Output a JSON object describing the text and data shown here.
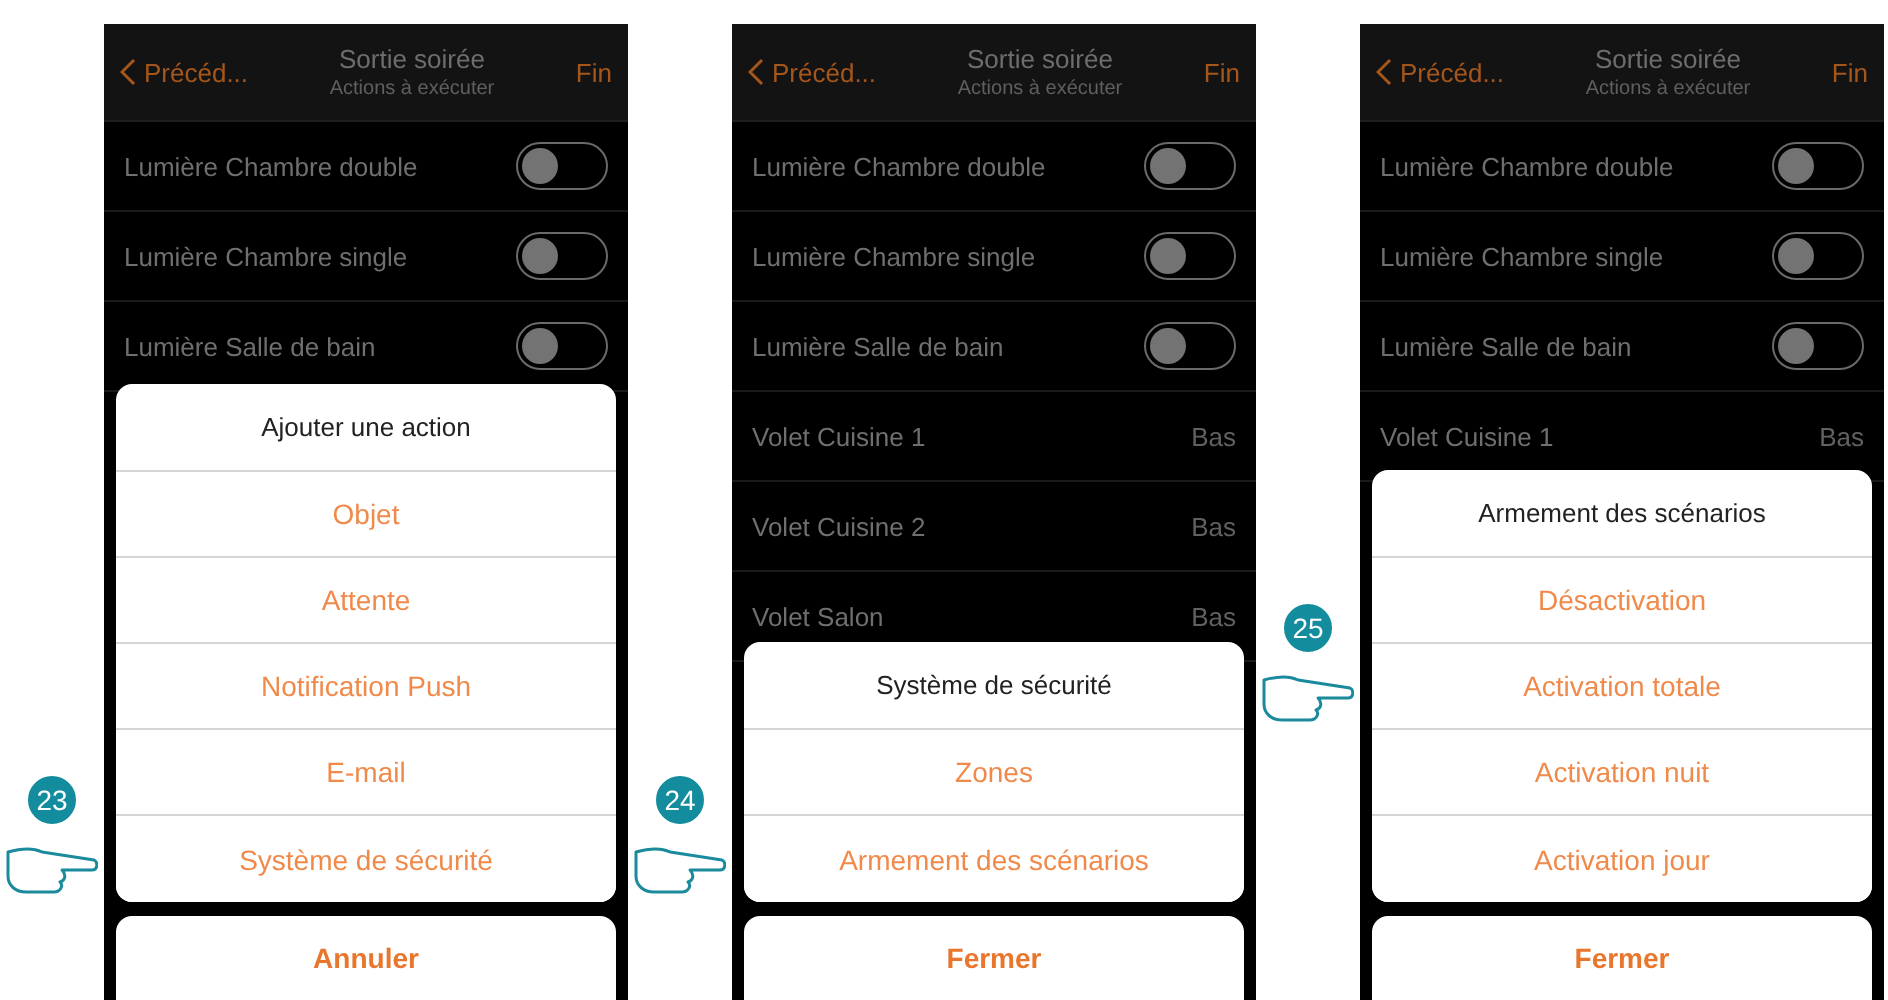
{
  "phones": [
    {
      "header": {
        "back": "Précéd...",
        "title": "Sortie soirée",
        "subtitle": "Actions à exécuter",
        "done": "Fin"
      },
      "rows": [
        {
          "kind": "toggle",
          "label": "Lumière Chambre double",
          "on": false
        },
        {
          "kind": "toggle",
          "label": "Lumière Chambre single",
          "on": false
        },
        {
          "kind": "toggle",
          "label": "Lumière Salle de bain",
          "on": false
        }
      ],
      "sheet": {
        "title": "Ajouter une action",
        "options": [
          "Objet",
          "Attente",
          "Notification Push",
          "E-mail",
          "Système de sécurité"
        ]
      },
      "cancel": "Annuler",
      "step": "23"
    },
    {
      "header": {
        "back": "Précéd...",
        "title": "Sortie soirée",
        "subtitle": "Actions à exécuter",
        "done": "Fin"
      },
      "rows": [
        {
          "kind": "toggle",
          "label": "Lumière Chambre double",
          "on": false
        },
        {
          "kind": "toggle",
          "label": "Lumière Chambre single",
          "on": false
        },
        {
          "kind": "toggle",
          "label": "Lumière Salle de bain",
          "on": false
        },
        {
          "kind": "value",
          "label": "Volet Cuisine 1",
          "value": "Bas"
        },
        {
          "kind": "value",
          "label": "Volet Cuisine 2",
          "value": "Bas"
        },
        {
          "kind": "value",
          "label": "Volet Salon",
          "value": "Bas"
        }
      ],
      "sheet": {
        "title": "Système de sécurité",
        "options": [
          "Zones",
          "Armement des scénarios"
        ]
      },
      "cancel": "Fermer",
      "step": "24"
    },
    {
      "header": {
        "back": "Précéd...",
        "title": "Sortie soirée",
        "subtitle": "Actions à exécuter",
        "done": "Fin"
      },
      "rows": [
        {
          "kind": "toggle",
          "label": "Lumière Chambre double",
          "on": false
        },
        {
          "kind": "toggle",
          "label": "Lumière Chambre single",
          "on": false
        },
        {
          "kind": "toggle",
          "label": "Lumière Salle de bain",
          "on": false
        },
        {
          "kind": "value",
          "label": "Volet Cuisine 1",
          "value": "Bas"
        }
      ],
      "sheet": {
        "title": "Armement des scénarios",
        "options": [
          "Désactivation",
          "Activation totale",
          "Activation nuit",
          "Activation jour"
        ]
      },
      "cancel": "Fermer",
      "step": "25"
    }
  ]
}
